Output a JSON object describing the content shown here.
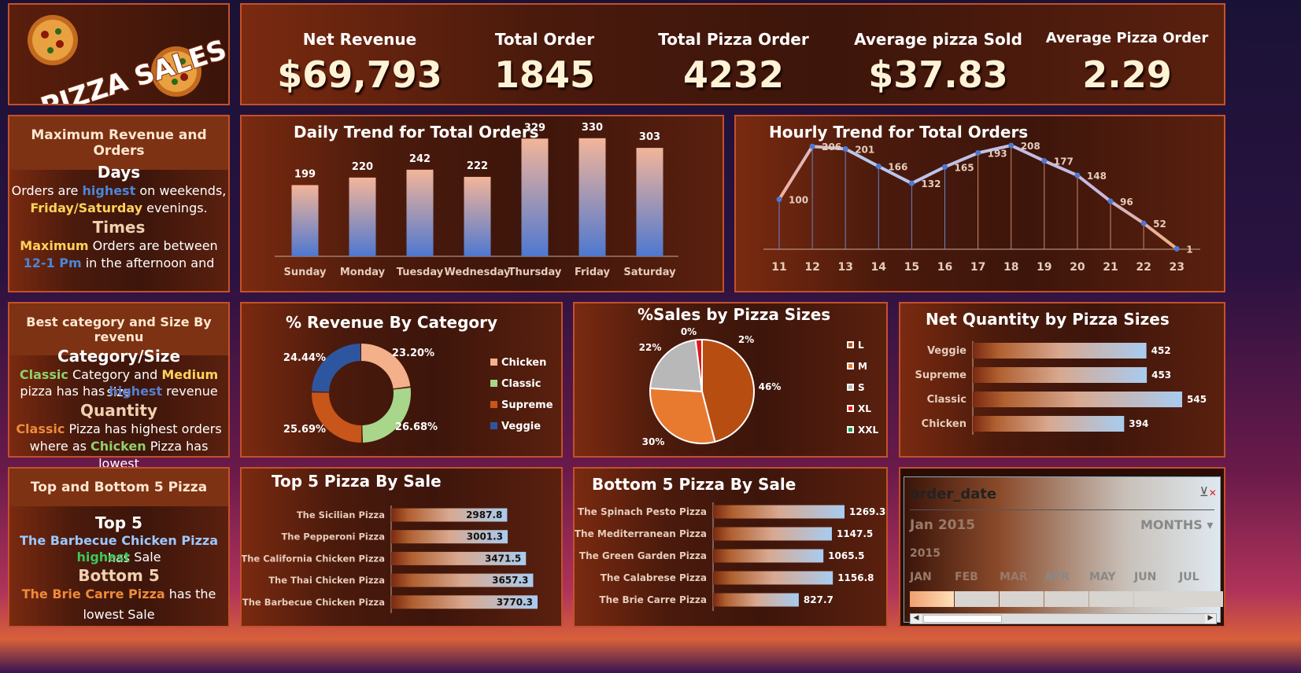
{
  "logo": {
    "text": "PIZZA SALES"
  },
  "kpis": [
    {
      "label": "Net Revenue",
      "value": "$69,793"
    },
    {
      "label": "Total Order",
      "value": "1845"
    },
    {
      "label": "Total Pizza Order",
      "value": "4232"
    },
    {
      "label": "Average pizza Sold",
      "value": "$37.83"
    },
    {
      "label": "Average Pizza Order",
      "value": "2.29"
    }
  ],
  "side1": {
    "header": "Maximum Revenue and Orders",
    "days_title": "Days",
    "l1a": "Orders are ",
    "l1b": "highest",
    "l1c": " on weekends,",
    "l2a": "Friday/Saturday",
    "l2b": " evenings.",
    "times_title": "Times",
    "l3a": "Maximum",
    "l3b": " Orders are between",
    "l4a": "12-1 Pm",
    "l4b": " in the afternoon and"
  },
  "side2": {
    "header": "Best category and Size By revenu",
    "cat_title": "Category/Size",
    "l1a": "Classic",
    "l1b": " Category and ",
    "l1c": "Medium",
    "l1d": " size",
    "l2a": "pizza has has ",
    "l2b": "highest",
    "l2c": " revenue",
    "qty_title": "Quantity",
    "l3a": "Classic",
    "l3b": " Pizza has highest orders",
    "l4a": "where as ",
    "l4b": "Chicken",
    "l4c": " Pizza has lowest"
  },
  "side3": {
    "header": "Top and Bottom 5 Pizza",
    "top_title": "Top 5",
    "l1a": "The Barbecue Chicken Pizza",
    "l1b": " has",
    "l2a": "highest",
    "l2b": " Sale",
    "bottom_title": "Bottom 5",
    "l3a": "The Brie Carre Pizza",
    "l3b": " has the",
    "l4": "lowest Sale"
  },
  "chart_data": [
    {
      "type": "bar",
      "title": "Daily Trend for Total Orders",
      "categories": [
        "Sunday",
        "Monday",
        "Tuesday",
        "Wednesday",
        "Thursday",
        "Friday",
        "Saturday"
      ],
      "values": [
        199,
        220,
        242,
        222,
        329,
        330,
        303
      ]
    },
    {
      "type": "line",
      "title": "Hourly Trend for Total Orders",
      "x": [
        "11",
        "12",
        "13",
        "14",
        "15",
        "16",
        "17",
        "18",
        "19",
        "20",
        "21",
        "22",
        "23"
      ],
      "values": [
        100,
        206,
        201,
        166,
        132,
        165,
        193,
        208,
        177,
        148,
        96,
        52,
        1
      ]
    },
    {
      "type": "pie",
      "title": "% Revenue By Category",
      "categories": [
        "Chicken",
        "Classic",
        "Supreme",
        "Veggie"
      ],
      "values": [
        23.2,
        26.68,
        25.69,
        24.44
      ],
      "labels": [
        "23.20%",
        "26.68%",
        "25.69%",
        "24.44%"
      ],
      "colors": [
        "#f3b08a",
        "#a8d68a",
        "#c8551a",
        "#2e56a0"
      ]
    },
    {
      "type": "pie",
      "title": "%Sales by Pizza Sizes",
      "categories": [
        "L",
        "M",
        "S",
        "XL",
        "XXL"
      ],
      "values": [
        46,
        30,
        22,
        2,
        0
      ],
      "labels": [
        "46%",
        "30%",
        "22%",
        "2%",
        "0%"
      ],
      "colors": [
        "#b84d12",
        "#e87a30",
        "#b8b8b8",
        "#e01818",
        "#1a9a5a"
      ]
    },
    {
      "type": "bar",
      "title": "Net Quantity by Pizza Sizes",
      "categories": [
        "Veggie",
        "Supreme",
        "Classic",
        "Chicken"
      ],
      "values": [
        452,
        453,
        545,
        394
      ]
    },
    {
      "type": "bar",
      "title": "Top 5 Pizza By Sale",
      "categories": [
        "The Sicilian Pizza",
        "The Pepperoni Pizza",
        "The California Chicken Pizza",
        "The Thai Chicken Pizza",
        "The Barbecue Chicken Pizza"
      ],
      "values": [
        2987.8,
        3001.3,
        3471.5,
        3657.3,
        3770.3
      ]
    },
    {
      "type": "bar",
      "title": "Bottom 5 Pizza By Sale",
      "categories": [
        "The Spinach Pesto Pizza",
        "The Mediterranean Pizza",
        "The Green Garden Pizza",
        "The Calabrese Pizza",
        "The Brie Carre Pizza"
      ],
      "values": [
        1269.3,
        1147.5,
        1065.5,
        1156.8,
        827.7
      ]
    }
  ],
  "slicer": {
    "title": "order_date",
    "period": "Jan 2015",
    "level": "MONTHS",
    "year": "2015",
    "months": [
      "JAN",
      "FEB",
      "MAR",
      "APR",
      "MAY",
      "JUN",
      "JUL"
    ]
  }
}
